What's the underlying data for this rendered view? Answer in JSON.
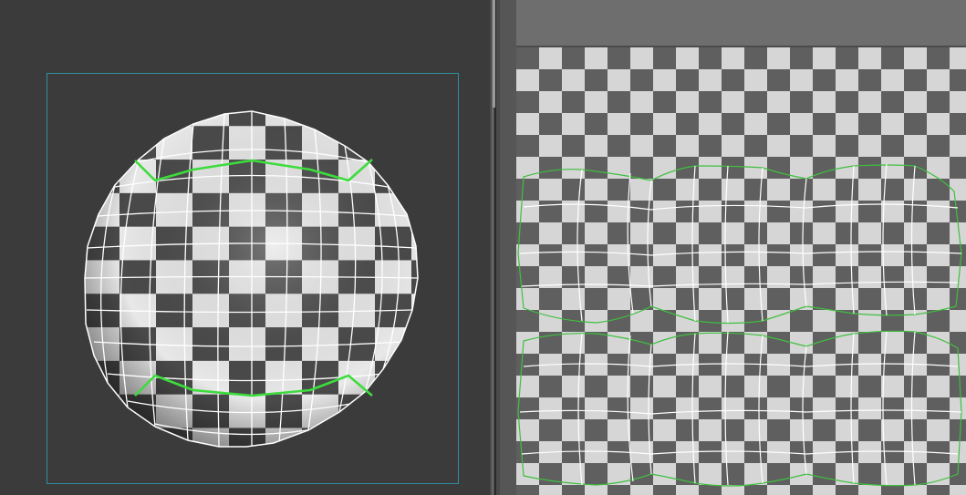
{
  "colors": {
    "viewport_bg": "#3b3b3b",
    "frame": "#2f8fa0",
    "checker_light": "#d8d8d8",
    "checker_dark": "#5e5e5e",
    "seam": "#3ddc3d",
    "wire": "#ffffff",
    "uv_border": "#3fbf3f"
  },
  "icons": {
    "splitter": "vertical-splitter-handle"
  }
}
